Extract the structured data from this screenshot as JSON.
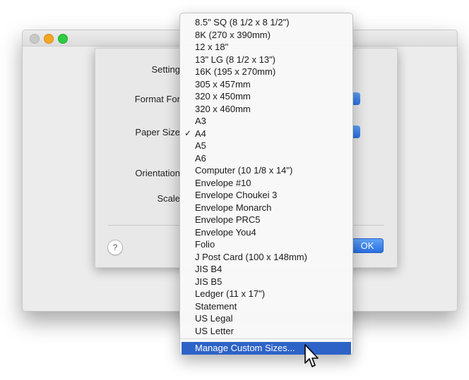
{
  "window": {
    "traffic_lights": [
      "close",
      "minimize",
      "zoom"
    ]
  },
  "page_setup": {
    "settings_label": "Setting",
    "format_for_label": "Format For",
    "paper_size_label": "Paper Size",
    "orientation_label": "Orientation",
    "scale_label": "Scale",
    "help_label": "?",
    "ok_label": "OK"
  },
  "paper_menu": {
    "selected": "A4",
    "items": [
      "8.5\" SQ (8 1/2 x 8 1/2\")",
      "8K (270 x 390mm)",
      "12 x 18\"",
      "13\" LG (8 1/2 x 13\")",
      "16K (195 x 270mm)",
      "305 x 457mm",
      "320 x 450mm",
      "320 x 460mm",
      "A3",
      "A4",
      "A5",
      "A6",
      "Computer (10 1/8 x 14\")",
      "Envelope #10",
      "Envelope Choukei 3",
      "Envelope Monarch",
      "Envelope PRC5",
      "Envelope You4",
      "Folio",
      "J Post Card (100 x 148mm)",
      "JIS B4",
      "JIS B5",
      "Ledger (11 x 17\")",
      "Statement",
      "US Legal",
      "US Letter"
    ],
    "check_mark": "✓",
    "manage_label": "Manage Custom Sizes..."
  },
  "colors": {
    "accent": "#2d63c7",
    "button_blue": "#3b82ee"
  }
}
